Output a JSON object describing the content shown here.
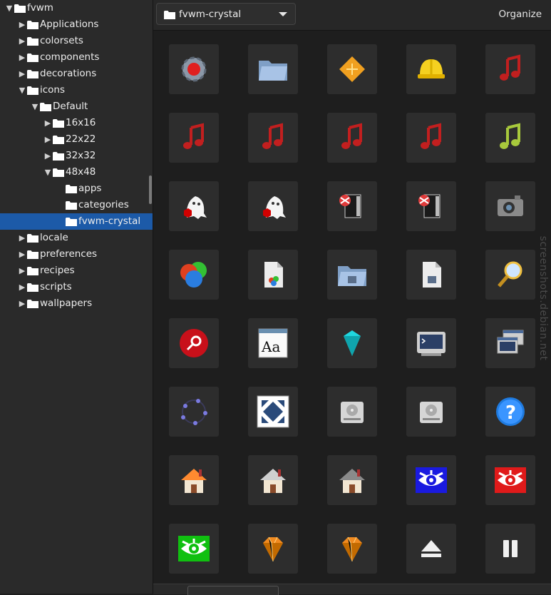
{
  "tree": {
    "items": [
      {
        "label": "fvwm",
        "expanded": true,
        "has_children": true
      },
      {
        "label": "Applications",
        "expanded": false,
        "has_children": true
      },
      {
        "label": "colorsets",
        "expanded": false,
        "has_children": true
      },
      {
        "label": "components",
        "expanded": false,
        "has_children": true
      },
      {
        "label": "decorations",
        "expanded": false,
        "has_children": true
      },
      {
        "label": "icons",
        "expanded": true,
        "has_children": true
      },
      {
        "label": "Default",
        "expanded": true,
        "has_children": true
      },
      {
        "label": "16x16",
        "expanded": false,
        "has_children": true
      },
      {
        "label": "22x22",
        "expanded": false,
        "has_children": true
      },
      {
        "label": "32x32",
        "expanded": false,
        "has_children": true
      },
      {
        "label": "48x48",
        "expanded": true,
        "has_children": true
      },
      {
        "label": "apps",
        "expanded": false,
        "has_children": false
      },
      {
        "label": "categories",
        "expanded": false,
        "has_children": false
      },
      {
        "label": "fvwm-crystal",
        "expanded": false,
        "has_children": false,
        "selected": true
      },
      {
        "label": "locale",
        "expanded": false,
        "has_children": true
      },
      {
        "label": "preferences",
        "expanded": false,
        "has_children": true
      },
      {
        "label": "recipes",
        "expanded": false,
        "has_children": true
      },
      {
        "label": "scripts",
        "expanded": false,
        "has_children": true
      },
      {
        "label": "wallpapers",
        "expanded": false,
        "has_children": true
      }
    ]
  },
  "toolbar": {
    "location": "fvwm-crystal",
    "organize_label": "Organize"
  },
  "icons": [
    "gear-icon",
    "folder-icon",
    "diamond-icon",
    "hardhat-icon",
    "music-note-icon",
    "music-note-icon",
    "music-note-icon",
    "music-note-icon",
    "music-note-icon",
    "music-note-green-icon",
    "ghost-icon",
    "ghost-icon",
    "window-icon",
    "window-icon",
    "camera-icon",
    "color-circles-icon",
    "document-icon",
    "folder-package-icon",
    "document-package-icon",
    "magnifier-icon",
    "search-icon",
    "font-icon",
    "crystal-icon",
    "terminal-icon",
    "windows-icon",
    "circle-dots-icon",
    "fullscreen-icon",
    "harddisk-icon",
    "harddisk-icon",
    "help-icon",
    "home-icon",
    "home-icon",
    "home-icon",
    "eye-blue-icon",
    "eye-red-icon",
    "eye-green-icon",
    "gem-icon",
    "gem-icon",
    "eject-icon",
    "pause-icon"
  ],
  "watermark": "screenshots.debian.net",
  "colors": {
    "selection": "#1c5aa8",
    "folder": "#ffffff",
    "background": "#1e1e1e"
  }
}
